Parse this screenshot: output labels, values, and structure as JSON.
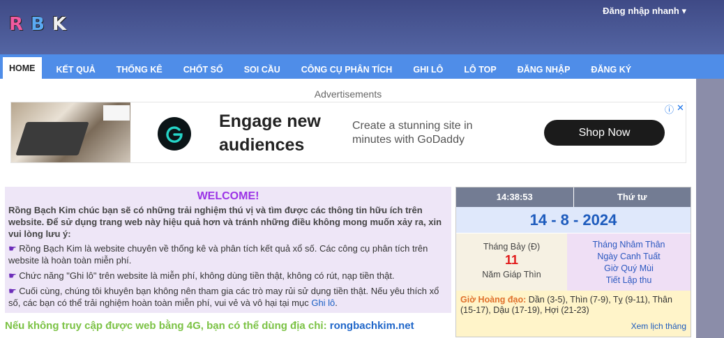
{
  "header": {
    "logo_letters": [
      "R",
      "B",
      "K"
    ],
    "quick_login": "Đăng nhập nhanh ▾"
  },
  "nav": {
    "items": [
      "HOME",
      "KẾT QUẢ",
      "THỐNG KÊ",
      "CHỐT SỐ",
      "SOI CẦU",
      "CÔNG CỤ PHÂN TÍCH",
      "GHI LÔ",
      "LÔ TOP",
      "ĐĂNG NHẬP",
      "ĐĂNG KÝ"
    ],
    "active": "HOME"
  },
  "ads": {
    "label": "Advertisements",
    "headline": "Engage new audiences",
    "text": "Create a stunning site in minutes with GoDaddy",
    "button": "Shop Now",
    "info_icon": "ⓘ",
    "close_icon": "✕"
  },
  "welcome": {
    "title": "WELCOME!",
    "intro": "Rồng Bạch Kim chúc bạn sẽ có những trải nghiệm thú vị và tìm được các thông tin hữu ích trên website. Để sử dụng trang web này hiệu quả hơn và tránh những điều không mong muốn xảy ra, xin vui lòng lưu ý:",
    "bullet_icon": "☛",
    "item1": "Rồng Bạch Kim là website chuyên về thống kê và phân tích kết quả xổ số. Các công cụ phân tích trên website là hoàn toàn miễn phí.",
    "item2": "Chức năng \"Ghi lô\" trên website là miễn phí, không dùng tiền thật, không có rút, nạp tiền thật.",
    "item3_text": "Cuối cùng, chúng tôi khuyên bạn không nên tham gia các trò may rủi sử dụng tiền thật. Nếu yêu thích xổ số, các bạn có thể trải nghiệm hoàn toàn miễn phí, vui vẻ và vô hại tại mục",
    "item3_link": "Ghi lô",
    "item3_end": "."
  },
  "alt_address": {
    "text": "Nếu không truy cập được web bằng 4G, bạn có thể dùng địa chỉ:",
    "link": "rongbachkim.net"
  },
  "calendar": {
    "time": "14:38:53",
    "weekday": "Thứ tư",
    "date": "14 - 8 - 2024",
    "lunar_month": "Tháng Bảy (Đ)",
    "lunar_day": "11",
    "lunar_year": "Năm Giáp Thìn",
    "can_chi": [
      "Tháng Nhâm Thân",
      "Ngày Canh Tuất",
      "Giờ Quý Mùi",
      "Tiết Lập thu"
    ],
    "gio_label": "Giờ Hoàng đạo:",
    "gio_text": "Dần (3-5), Thìn (7-9), Tỵ (9-11), Thân (15-17), Dậu (17-19), Hợi (21-23)",
    "month_link": "Xem lịch tháng"
  },
  "colors": {
    "nav": "#4f8de8",
    "header": "#46538f",
    "welcome_title": "#9b33e6",
    "alt_address": "#7bc244"
  }
}
